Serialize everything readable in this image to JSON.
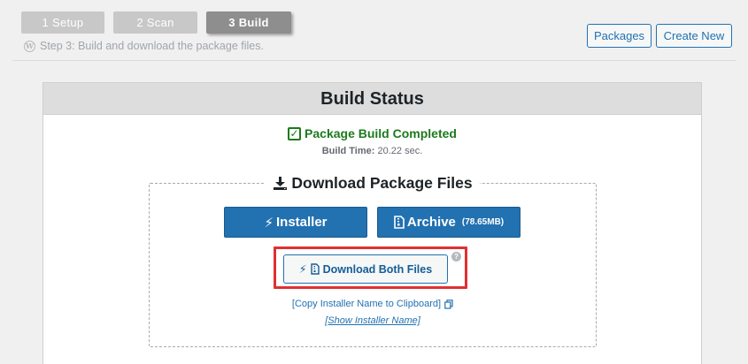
{
  "steps": [
    {
      "label": "1 Setup",
      "state": "done"
    },
    {
      "label": "2 Scan",
      "state": "done"
    },
    {
      "label": "3 Build",
      "state": "active"
    }
  ],
  "subtitle": "Step 3: Build and download the package files.",
  "header_buttons": {
    "packages": "Packages",
    "create_new": "Create New"
  },
  "panel": {
    "title": "Build Status",
    "status": "Package Build Completed",
    "build_time_label": "Build Time:",
    "build_time_value": "20.22 sec.",
    "download": {
      "legend": "Download Package Files",
      "installer_label": "Installer",
      "archive_label": "Archive",
      "archive_size": "(78.65MB)",
      "both_label": "Download Both Files",
      "help": "?",
      "copy_link": "[Copy Installer Name to Clipboard]",
      "show_link": "[Show Installer Name]"
    }
  },
  "colors": {
    "primary": "#2271b1",
    "success": "#1c7a1c",
    "highlight": "#e03030"
  },
  "icons": {
    "wordpress": "wordpress-icon",
    "check": "checkbox-checked-icon",
    "download": "download-icon",
    "bolt": "bolt-icon",
    "file": "file-zip-icon",
    "copy": "copy-icon",
    "help": "help-icon"
  }
}
